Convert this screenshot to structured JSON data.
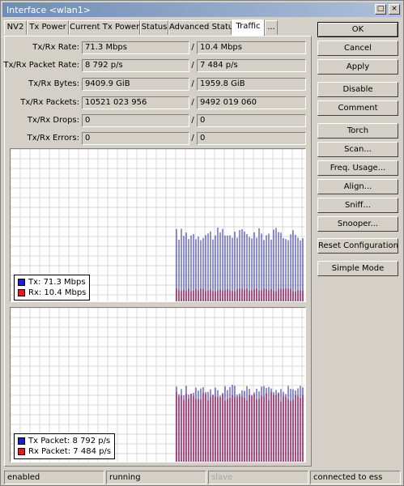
{
  "window": {
    "title": "Interface <wlan1>"
  },
  "titlebar_buttons": {
    "restore": "□",
    "close": "×"
  },
  "tabs": [
    {
      "label": "NV2"
    },
    {
      "label": "Tx Power"
    },
    {
      "label": "Current Tx Power"
    },
    {
      "label": "Status"
    },
    {
      "label": "Advanced Status"
    },
    {
      "label": "Traffic",
      "active": true
    },
    {
      "label": "..."
    }
  ],
  "stats": [
    {
      "label": "Tx/Rx Rate:",
      "tx": "71.3 Mbps",
      "rx": "10.4 Mbps"
    },
    {
      "label": "Tx/Rx Packet Rate:",
      "tx": "8 792 p/s",
      "rx": "7 484 p/s"
    },
    {
      "label": "Tx/Rx Bytes:",
      "tx": "9409.9 GiB",
      "rx": "1959.8 GiB"
    },
    {
      "label": "Tx/Rx Packets:",
      "tx": "10521 023 956",
      "rx": "9492 019 060"
    },
    {
      "label": "Tx/Rx Drops:",
      "tx": "0",
      "rx": "0"
    },
    {
      "label": "Tx/Rx Errors:",
      "tx": "0",
      "rx": "0"
    }
  ],
  "separator": "/",
  "graphs": {
    "rate": {
      "legend": [
        {
          "label": "Tx:  71.3 Mbps",
          "color": "#1a1ae6"
        },
        {
          "label": "Rx:  10.4 Mbps",
          "color": "#e61a1a"
        }
      ],
      "bar_colors": {
        "tx": "#4a4ab5",
        "rx": "#a0306a"
      }
    },
    "packets": {
      "legend": [
        {
          "label": "Tx Packet:  8 792 p/s",
          "color": "#1a1ae6"
        },
        {
          "label": "Rx Packet:  7 484 p/s",
          "color": "#e61a1a"
        }
      ],
      "bar_colors": {
        "tx": "#4a4ab5",
        "rx": "#a0306a"
      }
    }
  },
  "buttons": {
    "ok": "OK",
    "cancel": "Cancel",
    "apply": "Apply",
    "disable": "Disable",
    "comment": "Comment",
    "torch": "Torch",
    "scan": "Scan...",
    "freq_usage": "Freq. Usage...",
    "align": "Align...",
    "sniff": "Sniff...",
    "snooper": "Snooper...",
    "reset_configuration": "Reset Configuration",
    "simple_mode": "Simple Mode"
  },
  "status_bar": {
    "state": "enabled",
    "running": "running",
    "slave": "slave",
    "connection": "connected to ess"
  }
}
